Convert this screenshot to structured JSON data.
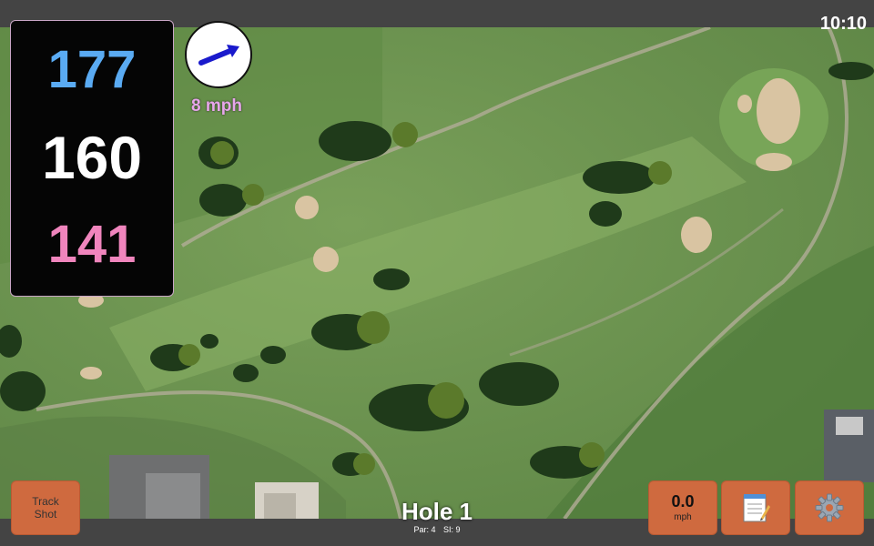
{
  "status_bar": {
    "time": "10:10"
  },
  "distances": {
    "back": "177",
    "center": "160",
    "front": "141"
  },
  "wind": {
    "speed": "8 mph",
    "icon": "wind-arrow-icon"
  },
  "hole": {
    "title": "Hole 1",
    "par": "Par: 4",
    "stroke_index": "SI: 9"
  },
  "buttons": {
    "track_shot_line1": "Track",
    "track_shot_line2": "Shot",
    "speed_value": "0.0",
    "speed_unit": "mph",
    "notes_icon": "notepad-icon",
    "settings_icon": "gear-icon"
  },
  "colors": {
    "back_distance": "#5aabf3",
    "center_distance": "#ffffff",
    "front_distance": "#f085bd",
    "button_bg": "#cf6a3f",
    "wind_label": "#e7a6ea"
  }
}
